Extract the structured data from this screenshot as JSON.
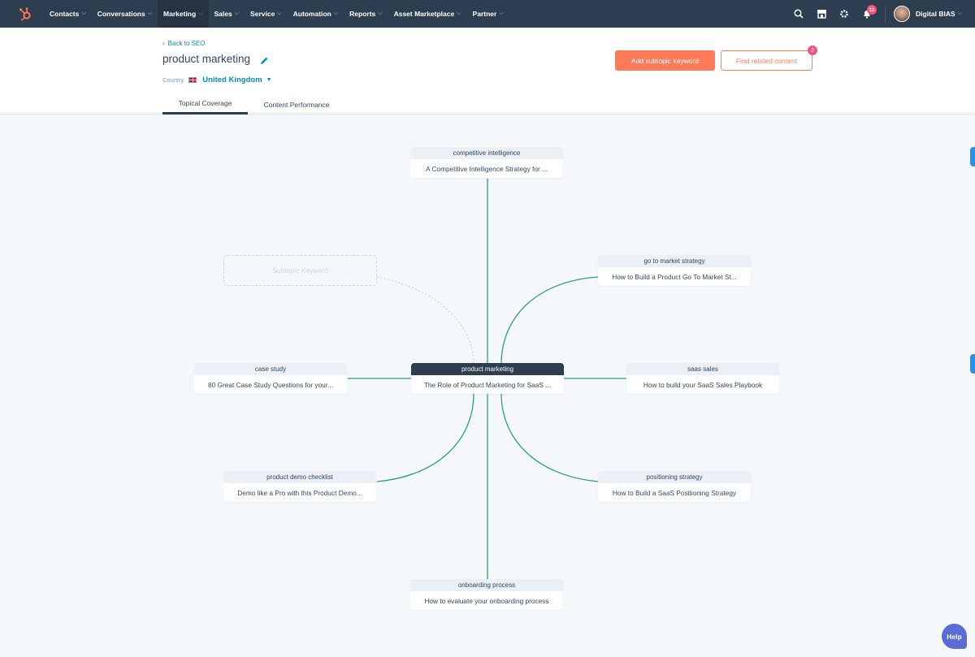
{
  "nav": {
    "logo": "hubspot-logo",
    "items": [
      {
        "label": "Contacts",
        "active": false
      },
      {
        "label": "Conversations",
        "active": false
      },
      {
        "label": "Marketing",
        "active": true
      },
      {
        "label": "Sales",
        "active": false
      },
      {
        "label": "Service",
        "active": false
      },
      {
        "label": "Automation",
        "active": false
      },
      {
        "label": "Reports",
        "active": false
      },
      {
        "label": "Asset Marketplace",
        "active": false
      },
      {
        "label": "Partner",
        "active": false
      }
    ],
    "icons": [
      "search-icon",
      "marketplace-icon",
      "settings-icon",
      "notifications-icon"
    ],
    "notification_count": "11",
    "account_name": "Digital BIAS"
  },
  "header": {
    "back_link": "Back to SEO",
    "title": "product marketing",
    "country_label": "Country",
    "country_value": "United Kingdom",
    "add_button": "Add subtopic keyword",
    "find_button": "Find related content",
    "find_badge": "2",
    "tabs": [
      {
        "label": "Topical Coverage",
        "active": true
      },
      {
        "label": "Content Performance",
        "active": false
      }
    ]
  },
  "topic_map": {
    "center": {
      "keyword": "product marketing",
      "content": "The Role of Product Marketing for SaaS ..."
    },
    "subtopics": [
      {
        "keyword": "competitive intelligence",
        "content": "A Competitive Intelligence Strategy for ..."
      },
      {
        "keyword": "go to market strategy",
        "content": "How to Build a Product Go To Market St..."
      },
      {
        "keyword": "saas sales",
        "content": "How to build your SaaS Sales Playbook"
      },
      {
        "keyword": "positioning strategy",
        "content": "How to Build a SaaS Positioning Strategy"
      },
      {
        "keyword": "onboarding process",
        "content": "How to evaluate your onboarding process"
      },
      {
        "keyword": "product demo checklist",
        "content": "Demo like a Pro with this Product Demo..."
      },
      {
        "keyword": "case study",
        "content": "80 Great Case Study Questions for your..."
      }
    ],
    "placeholder": "Subtopic Keyword",
    "link_color": "#2e9c8a"
  },
  "help_label": "Help"
}
